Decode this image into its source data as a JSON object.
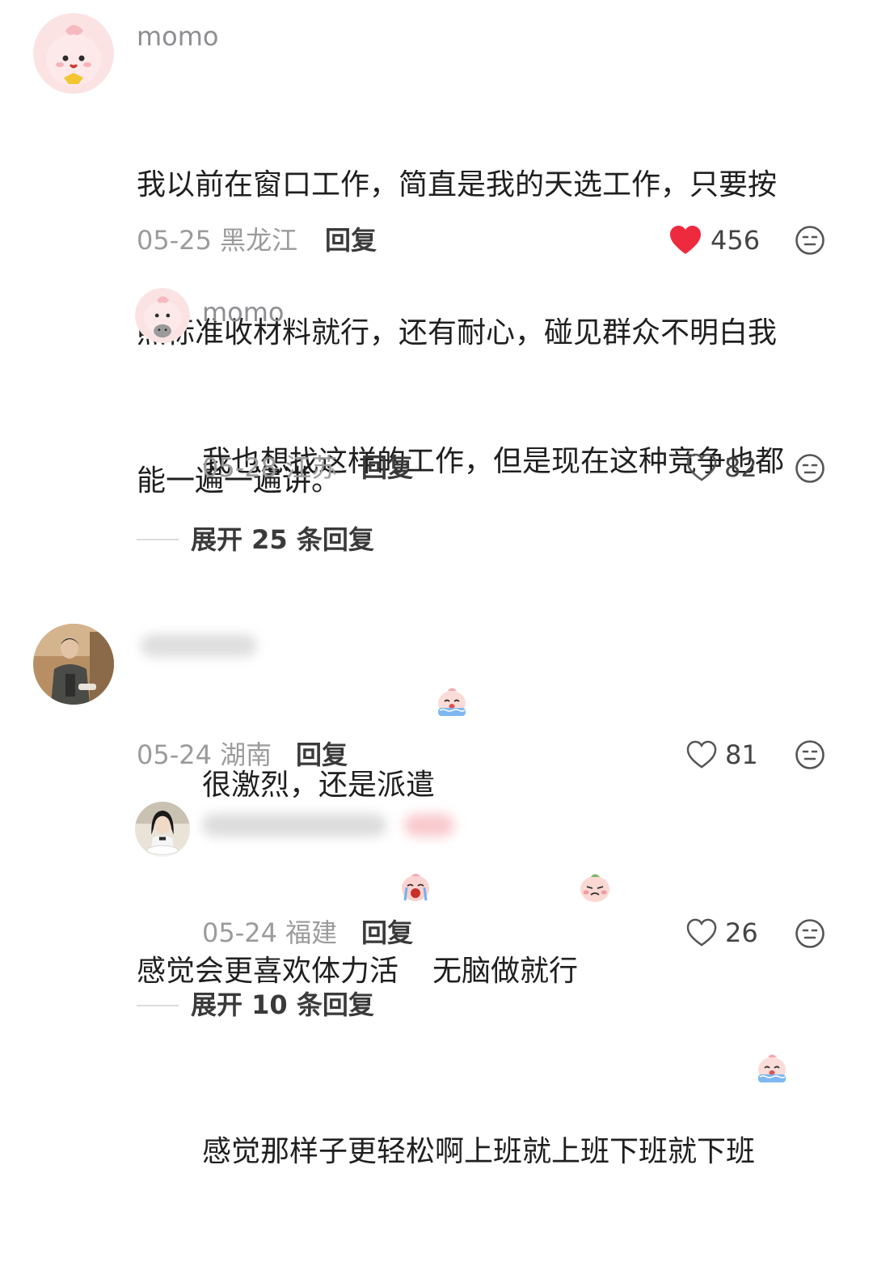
{
  "comments": [
    {
      "username": "momo",
      "text_line1": "我以前在窗口工作，简直是我的天选工作，只要按",
      "text_line2": "照标准收材料就行，还有耐心，碰见群众不明白我",
      "text_line3": "能一遍一遍讲。",
      "date_location": "05-25 黑龙江",
      "reply_label": "回复",
      "likes": "456",
      "liked": true,
      "avatar_icon": "pink-peach-avatar",
      "replies": [
        {
          "username": "momo",
          "text_line1": "我也想找这样的工作，但是现在这种竞争也都",
          "text_line2": "很激烈，还是派遣",
          "emoji": "crying-peach-emoji",
          "date_location": "05-28 江苏",
          "reply_label": "回复",
          "likes": "82",
          "avatar_icon": "pink-peach-cat-avatar"
        }
      ],
      "expand_label": "展开 25 条回复"
    },
    {
      "username": "",
      "text_part1": "感觉会更喜欢体力活",
      "emoji1": "sobbing-peach-emoji",
      "text_part2": "无脑做就行",
      "emoji2": "sad-peach-emoji",
      "date_location": "05-24 湖南",
      "reply_label": "回复",
      "likes": "81",
      "avatar_icon": "man-photo-avatar",
      "replies": [
        {
          "username": "",
          "text": "感觉那样子更轻松啊上班就上班下班就下班",
          "emoji": "crying-peach-emoji",
          "date_location": "05-24 福建",
          "reply_label": "回复",
          "likes": "26",
          "avatar_icon": "girl-photo-avatar"
        }
      ],
      "expand_label": "展开 10 条回复"
    }
  ],
  "colors": {
    "liked_heart": "#ee2a3e",
    "meta_gray": "#9b9b9b",
    "username_gray": "#8e8e93"
  }
}
